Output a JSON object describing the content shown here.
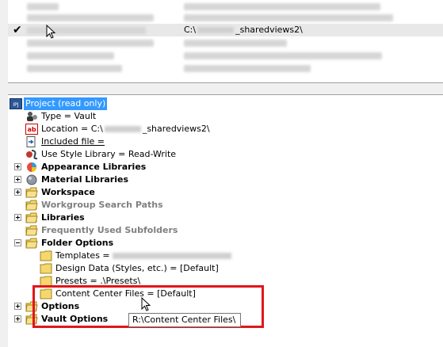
{
  "projects_list": {
    "rows": [
      {
        "check": "",
        "name_blurred": true,
        "path_blurred": true
      },
      {
        "check": "",
        "name_blurred": true,
        "path_blurred": true
      },
      {
        "check": "✔",
        "name_blurred": true,
        "path_prefix": "C:\\",
        "path_suffix": "_sharedviews2\\",
        "selected": true
      },
      {
        "check": "",
        "name_blurred": true,
        "path_blurred": true
      },
      {
        "check": "",
        "name_blurred": true,
        "path_blurred": true
      },
      {
        "check": "",
        "name_blurred": true,
        "path_blurred": true
      }
    ]
  },
  "tree": {
    "root": {
      "label": "Project (read only)",
      "icon": "ipj-project-icon"
    },
    "properties": {
      "type": "Type = Vault",
      "location_prefix": "Location = C:\\",
      "location_suffix": "_sharedviews2\\",
      "included_file": "Included file =",
      "use_style_library": "Use Style Library = Read-Write"
    },
    "groups": [
      {
        "label": "Appearance Libraries",
        "icon": "appearance-library-icon",
        "style": "bold"
      },
      {
        "label": "Material Libraries",
        "icon": "material-library-icon",
        "style": "bold"
      },
      {
        "label": "Workspace",
        "icon": "folder-icon",
        "style": "bold"
      },
      {
        "label": "Workgroup Search Paths",
        "icon": "folder-icon",
        "style": "bold-gray"
      },
      {
        "label": "Libraries",
        "icon": "folder-icon",
        "style": "bold"
      },
      {
        "label": "Frequently Used Subfolders",
        "icon": "folder-icon",
        "style": "bold-gray"
      },
      {
        "label": "Folder Options",
        "icon": "folder-icon",
        "style": "bold",
        "expanded": true
      }
    ],
    "folder_options": {
      "templates": "Templates =",
      "design_data": "Design Data (Styles, etc.) = [Default]",
      "presets": "Presets = .\\Presets\\",
      "content_center": "Content Center Files = [Default]"
    },
    "tail_groups": [
      {
        "label": "Options",
        "icon": "folder-icon",
        "style": "bold"
      },
      {
        "label": "Vault Options",
        "icon": "folder-icon",
        "style": "bold"
      }
    ]
  },
  "tooltip": {
    "text": "R:\\Content Center Files\\"
  },
  "colors": {
    "selection": "#3399ff",
    "highlight": "#e0161b",
    "folder": "#f5d76e"
  }
}
